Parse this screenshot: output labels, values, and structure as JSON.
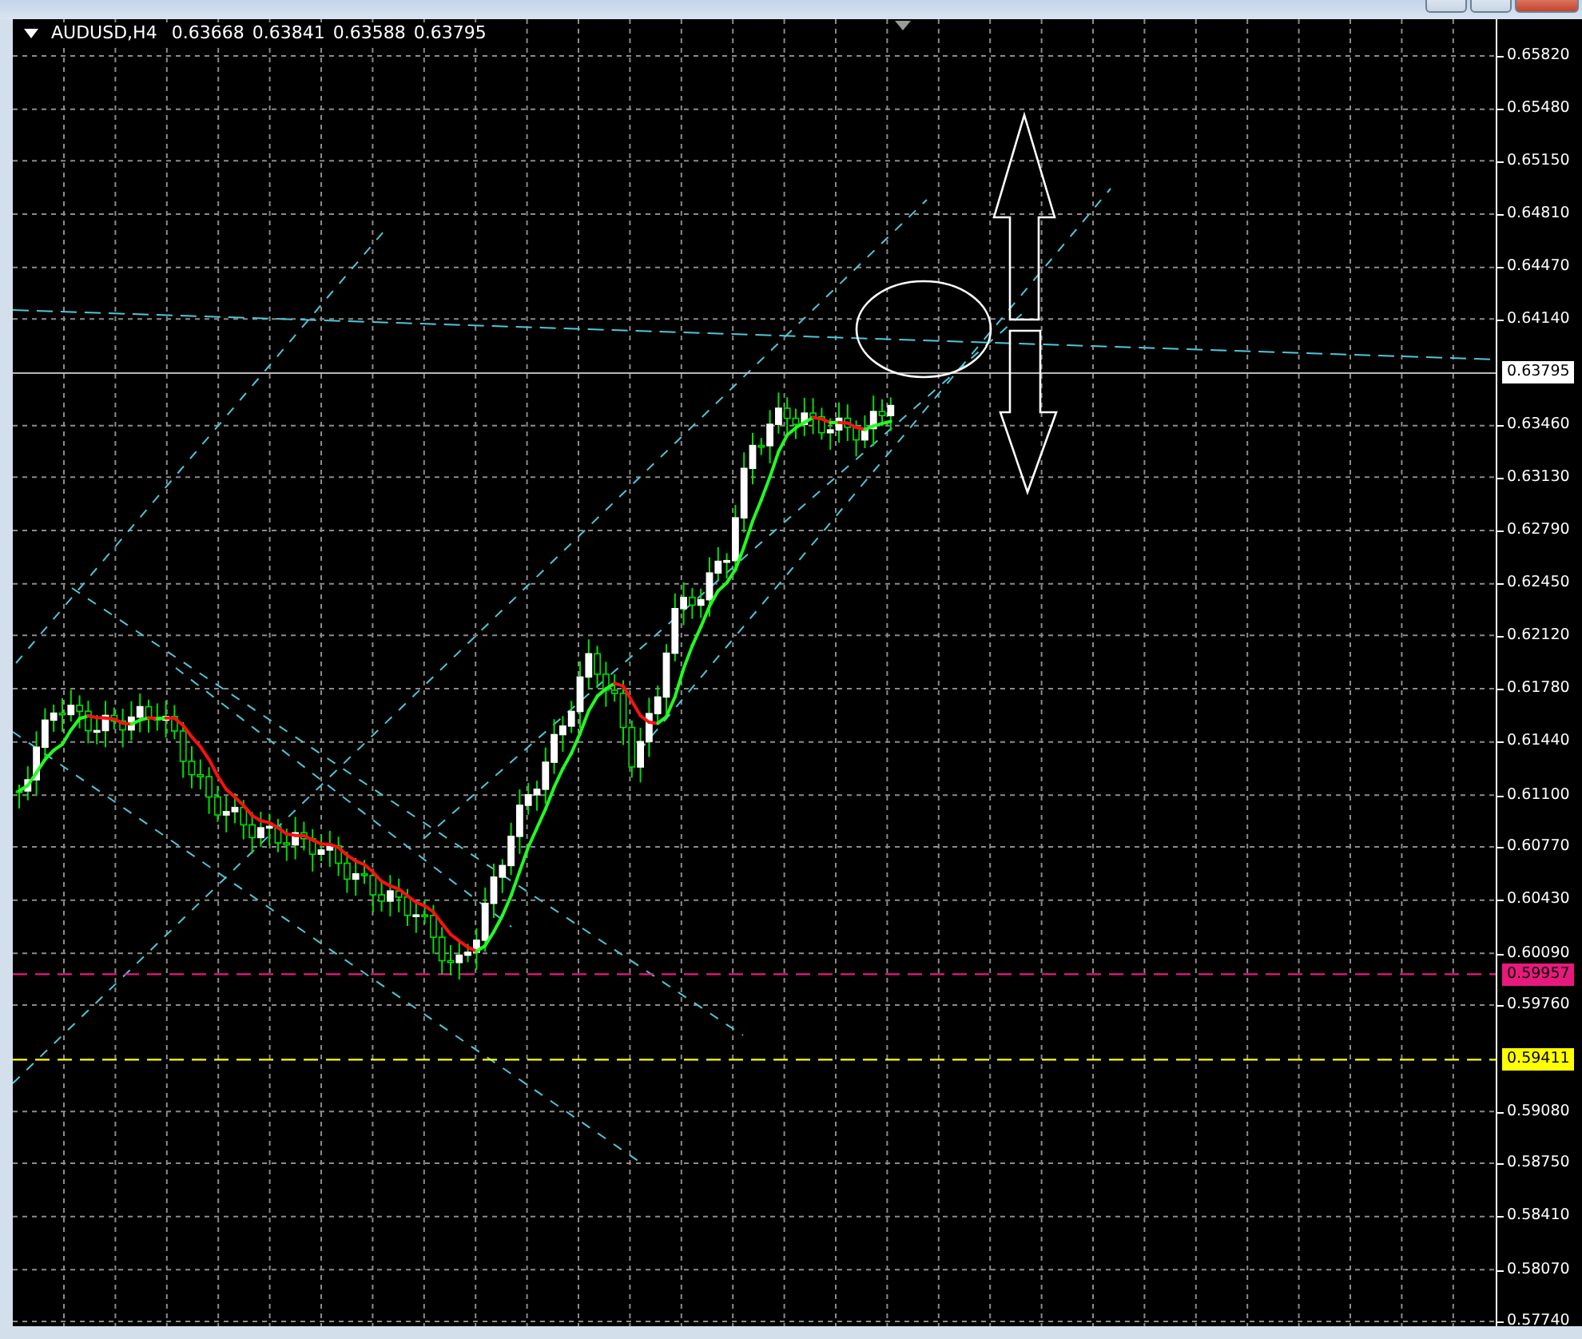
{
  "chart": {
    "symbol": "AUDUSD,H4",
    "quotes": [
      "0.63668",
      "0.63841",
      "0.63588",
      "0.63795"
    ]
  },
  "price_axis": {
    "labels": [
      "0.65820",
      "0.65480",
      "0.65150",
      "0.64810",
      "0.64470",
      "0.64140",
      "0.63460",
      "0.63130",
      "0.62790",
      "0.62450",
      "0.62120",
      "0.61780",
      "0.61440",
      "0.61100",
      "0.60770",
      "0.60430",
      "0.60090",
      "0.59760",
      "0.59080",
      "0.58750",
      "0.58410",
      "0.58070",
      "0.57740"
    ]
  },
  "price_markers": [
    {
      "label": "0.63795",
      "kind": "bid",
      "color": "#ffffff"
    },
    {
      "label": "0.59957",
      "kind": "level",
      "color": "#e8197c"
    },
    {
      "label": "0.59411",
      "kind": "level",
      "color": "#ffff00"
    }
  ]
}
